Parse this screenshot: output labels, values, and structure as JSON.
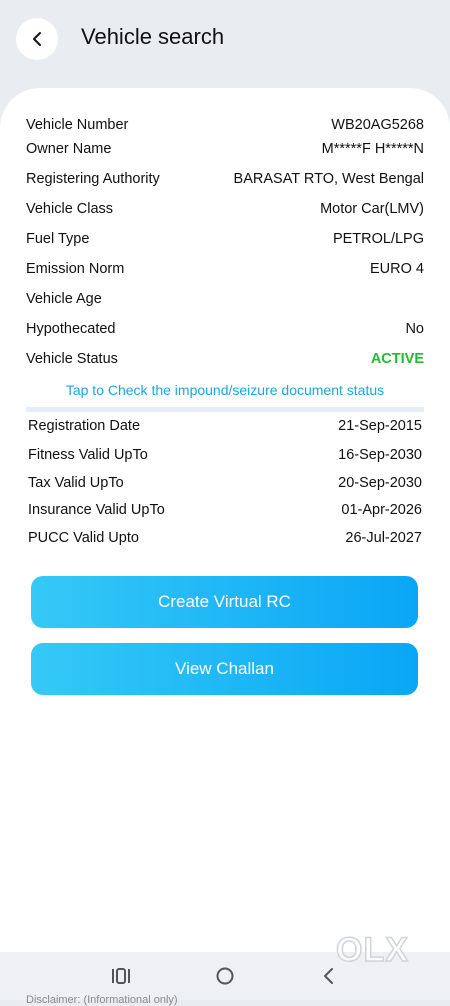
{
  "header": {
    "title": "Vehicle search"
  },
  "details": [
    {
      "label": "Vehicle Number",
      "value": "WB20AG5268"
    },
    {
      "label": "Owner Name",
      "value": "M*****F H*****N"
    },
    {
      "label": "Registering Authority",
      "value": "BARASAT RTO, West Bengal"
    },
    {
      "label": "Vehicle Class",
      "value": "Motor Car(LMV)"
    },
    {
      "label": "Fuel Type",
      "value": "PETROL/LPG"
    },
    {
      "label": "Emission Norm",
      "value": "EURO 4"
    },
    {
      "label": "Vehicle Age",
      "value": ""
    },
    {
      "label": "Hypothecated",
      "value": "No"
    },
    {
      "label": "Vehicle Status",
      "value": "ACTIVE"
    }
  ],
  "impound_link": "Tap to Check the impound/seizure document status",
  "validity": [
    {
      "label": "Registration Date",
      "value": "21-Sep-2015"
    },
    {
      "label": "Fitness Valid UpTo",
      "value": "16-Sep-2030"
    },
    {
      "label": "Tax Valid UpTo",
      "value": "20-Sep-2030"
    },
    {
      "label": "Insurance Valid UpTo",
      "value": "01-Apr-2026"
    },
    {
      "label": "PUCC Valid Upto",
      "value": "26-Jul-2027"
    }
  ],
  "buttons": {
    "virtual_rc": "Create Virtual RC",
    "challan": "View Challan"
  },
  "watermark": "OLX",
  "bottom_partial_text": "Disclaimer: (Informational only)",
  "colors": {
    "accent": "#1aa7e8",
    "status_active": "#1fbf2f",
    "button": "#0aa6f6"
  },
  "icons": [
    "back-arrow-icon",
    "recent-apps-icon",
    "home-icon",
    "nav-back-icon"
  ]
}
